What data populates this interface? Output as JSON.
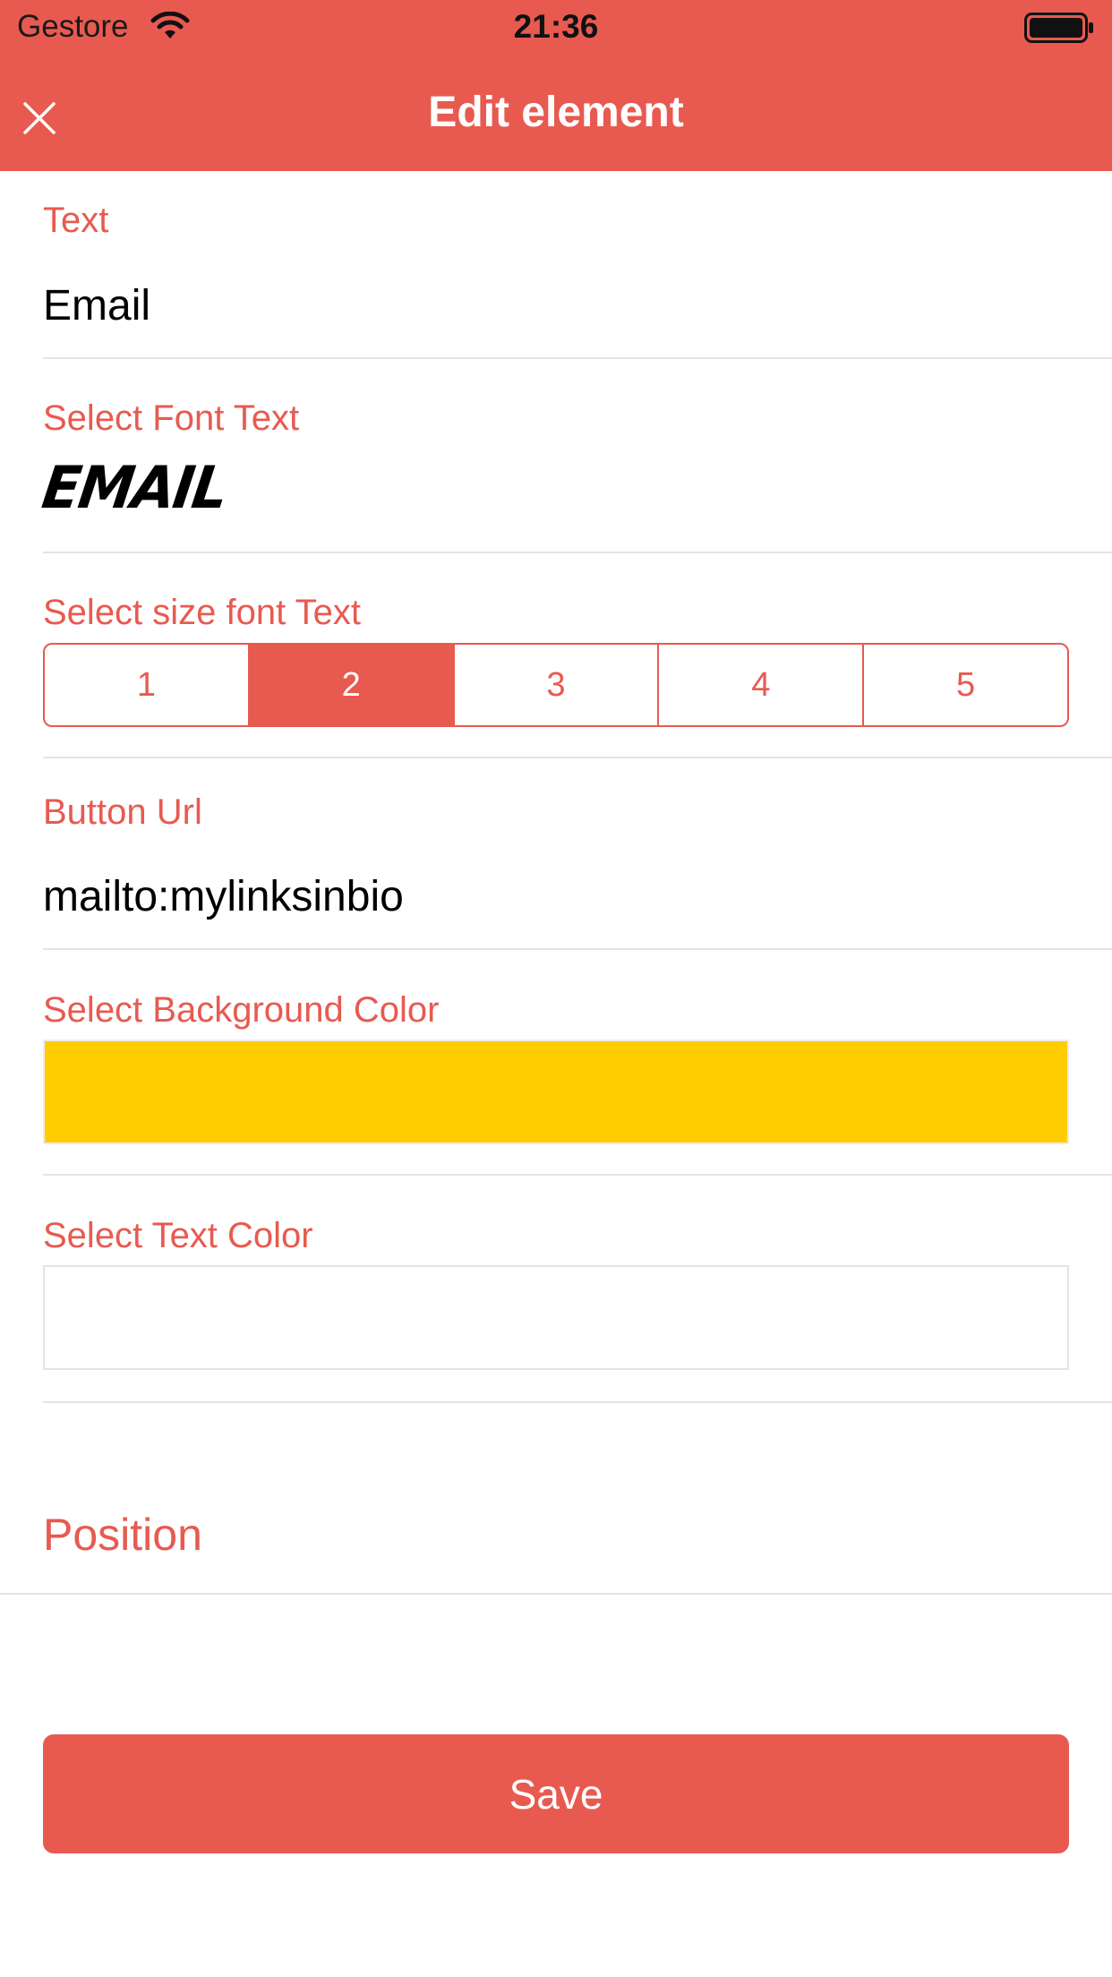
{
  "status_bar": {
    "carrier": "Gestore",
    "time": "21:36",
    "wifi_icon": "wifi-icon",
    "battery_icon": "battery-full-icon"
  },
  "nav": {
    "title": "Edit element",
    "close_icon": "close-icon"
  },
  "form": {
    "text_label": "Text",
    "text_value": "Email",
    "font_label": "Select Font Text",
    "font_preview": "EMAIL",
    "size_label": "Select size font Text",
    "size_options": [
      "1",
      "2",
      "3",
      "4",
      "5"
    ],
    "size_selected": "2",
    "url_label": "Button Url",
    "url_value": "mailto:mylinksinbio",
    "bg_color_label": "Select Background Color",
    "bg_color": "#FFCC00",
    "text_color_label": "Select Text Color",
    "text_color": "#FFFFFF",
    "position_label": "Position"
  },
  "actions": {
    "save_label": "Save"
  },
  "colors": {
    "accent": "#E85A50",
    "divider": "#E4E4E4"
  }
}
